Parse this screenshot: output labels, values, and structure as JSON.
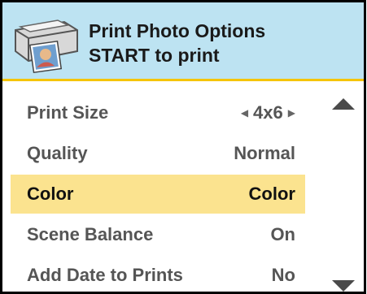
{
  "header": {
    "title_line1": "Print Photo Options",
    "title_line2": "START to print",
    "icon": "printer-with-photo-icon"
  },
  "colors": {
    "header_bg": "#bde3f2",
    "header_border": "#f5c400",
    "selected_bg": "#fbe38f"
  },
  "menu": {
    "selected_index": 2,
    "items": [
      {
        "label": "Print Size",
        "value": "4x6",
        "has_arrows": true
      },
      {
        "label": "Quality",
        "value": "Normal"
      },
      {
        "label": "Color",
        "value": "Color"
      },
      {
        "label": "Scene Balance",
        "value": "On"
      },
      {
        "label": "Add Date to Prints",
        "value": "No"
      }
    ]
  },
  "scroll": {
    "up_icon": "triangle-up-icon",
    "down_icon": "triangle-down-icon"
  }
}
